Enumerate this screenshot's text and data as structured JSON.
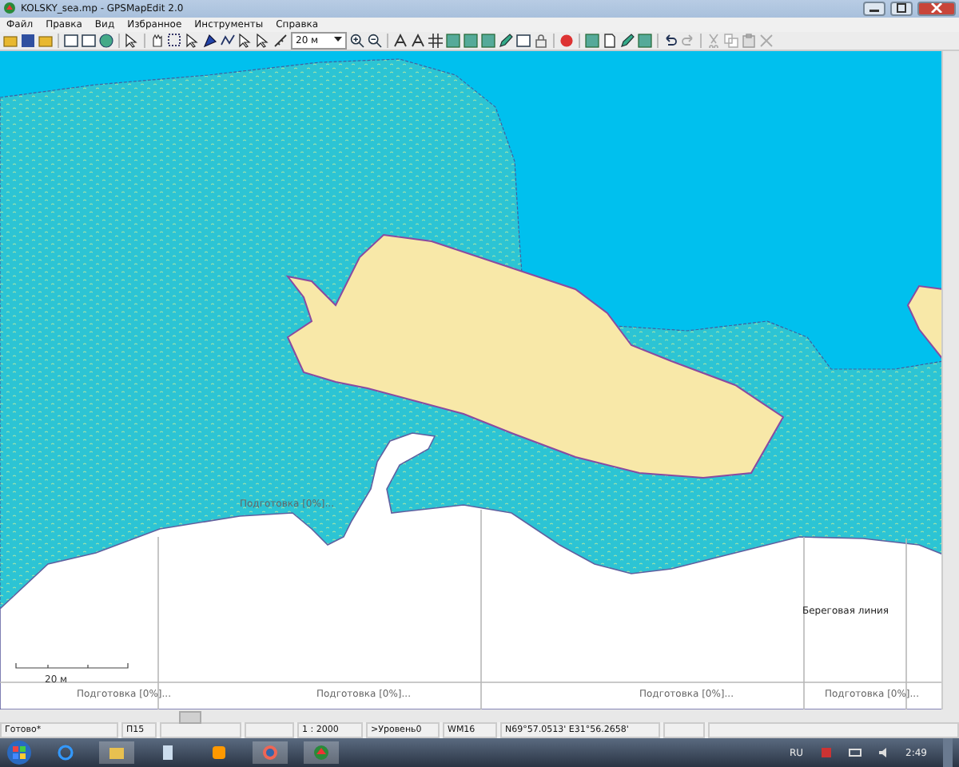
{
  "window": {
    "title": "KOLSKY_sea.mp - GPSMapEdit 2.0"
  },
  "menu": [
    "Файл",
    "Правка",
    "Вид",
    "Избранное",
    "Инструменты",
    "Справка"
  ],
  "toolbar": {
    "zoom_select": "20 м"
  },
  "map": {
    "tile_labels": [
      "Подготовка [0%]...",
      "Подготовка [0%]...",
      "Подготовка [0%]...",
      "Подготовка [0%]..."
    ],
    "inner_label": "Подготовка [0%]...",
    "feature_label": "Береговая линия",
    "scale_label": "20 м"
  },
  "status_bar": {
    "status": "Готово*",
    "object": "П15",
    "scale": "1 : 2000",
    "level": ">Уровень0",
    "type": "WM16",
    "coordinates": "N69°57.0513' E31°56.2658'"
  },
  "taskbar": {
    "language": "RU",
    "clock": "2:49"
  }
}
